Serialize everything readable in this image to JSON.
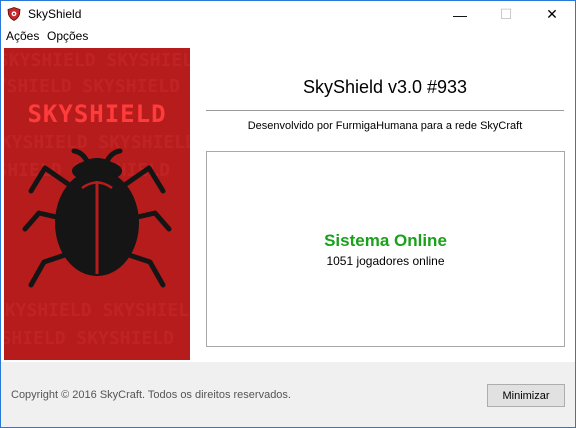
{
  "window": {
    "title": "SkyShield",
    "app_icon": "shield-icon"
  },
  "controls": {
    "minimize": "—",
    "maximize": "☐",
    "close": "✕"
  },
  "menu": {
    "items": [
      "Ações",
      "Opções"
    ]
  },
  "banner": {
    "title": "SKYSHIELD",
    "icon": "bug-icon",
    "background_color": "#b71c1c",
    "title_color": "#ff3b3b",
    "watermark_text": "SKYSHIELD SKYSHIELD"
  },
  "main": {
    "version": "SkyShield v3.0 #933",
    "credits": "Desenvolvido por FurmigaHumana para a rede SkyCraft"
  },
  "status": {
    "title": "Sistema Online",
    "subtitle": "1051 jogadores online",
    "title_color": "#1aa11a"
  },
  "footer": {
    "copyright": "Copyright © 2016 SkyCraft. Todos os direitos reservados.",
    "minimize_button": "Minimizar"
  }
}
